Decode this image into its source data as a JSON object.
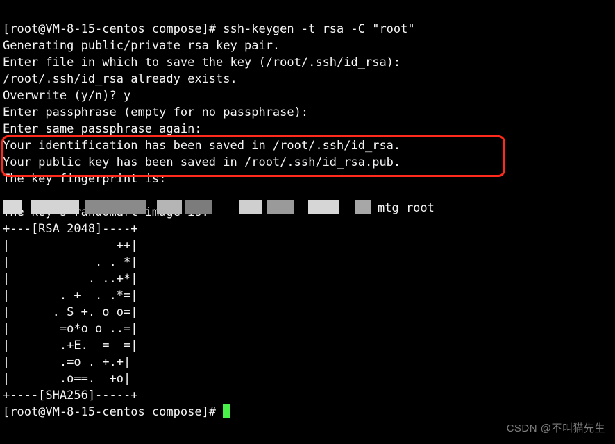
{
  "prompt1": "[root@VM-8-15-centos compose]# ",
  "command1": "ssh-keygen -t rsa -C \"root\"",
  "line_generating": "Generating public/private rsa key pair.",
  "line_enter_file": "Enter file in which to save the key (/root/.ssh/id_rsa):",
  "line_already_exists": "/root/.ssh/id_rsa already exists.",
  "line_overwrite": "Overwrite (y/n)? y",
  "line_passphrase": "Enter passphrase (empty for no passphrase):",
  "line_same_passphrase": "Enter same passphrase again:",
  "line_saved_id": "Your identification has been saved in /root/.ssh/id_rsa.",
  "line_saved_pub": "Your public key has been saved in /root/.ssh/id_rsa.pub.",
  "line_fingerprint": "The key fingerprint is:",
  "fingerprint_suffix": "mtg root",
  "line_randomart": "The key's randomart image is:",
  "randomart": [
    "+---[RSA 2048]----+",
    "|               ++|",
    "|            . . *|",
    "|           . ..+*|",
    "|       . +  . .*=|",
    "|      . S +. o o=|",
    "|       =o*o o ..=|",
    "|       .+E.  =  =|",
    "|       .=o . +.+|",
    "|       .o==.  +o|",
    "+----[SHA256]-----+"
  ],
  "prompt2": "[root@VM-8-15-centos compose]# ",
  "watermark": "CSDN @不叫猫先生"
}
